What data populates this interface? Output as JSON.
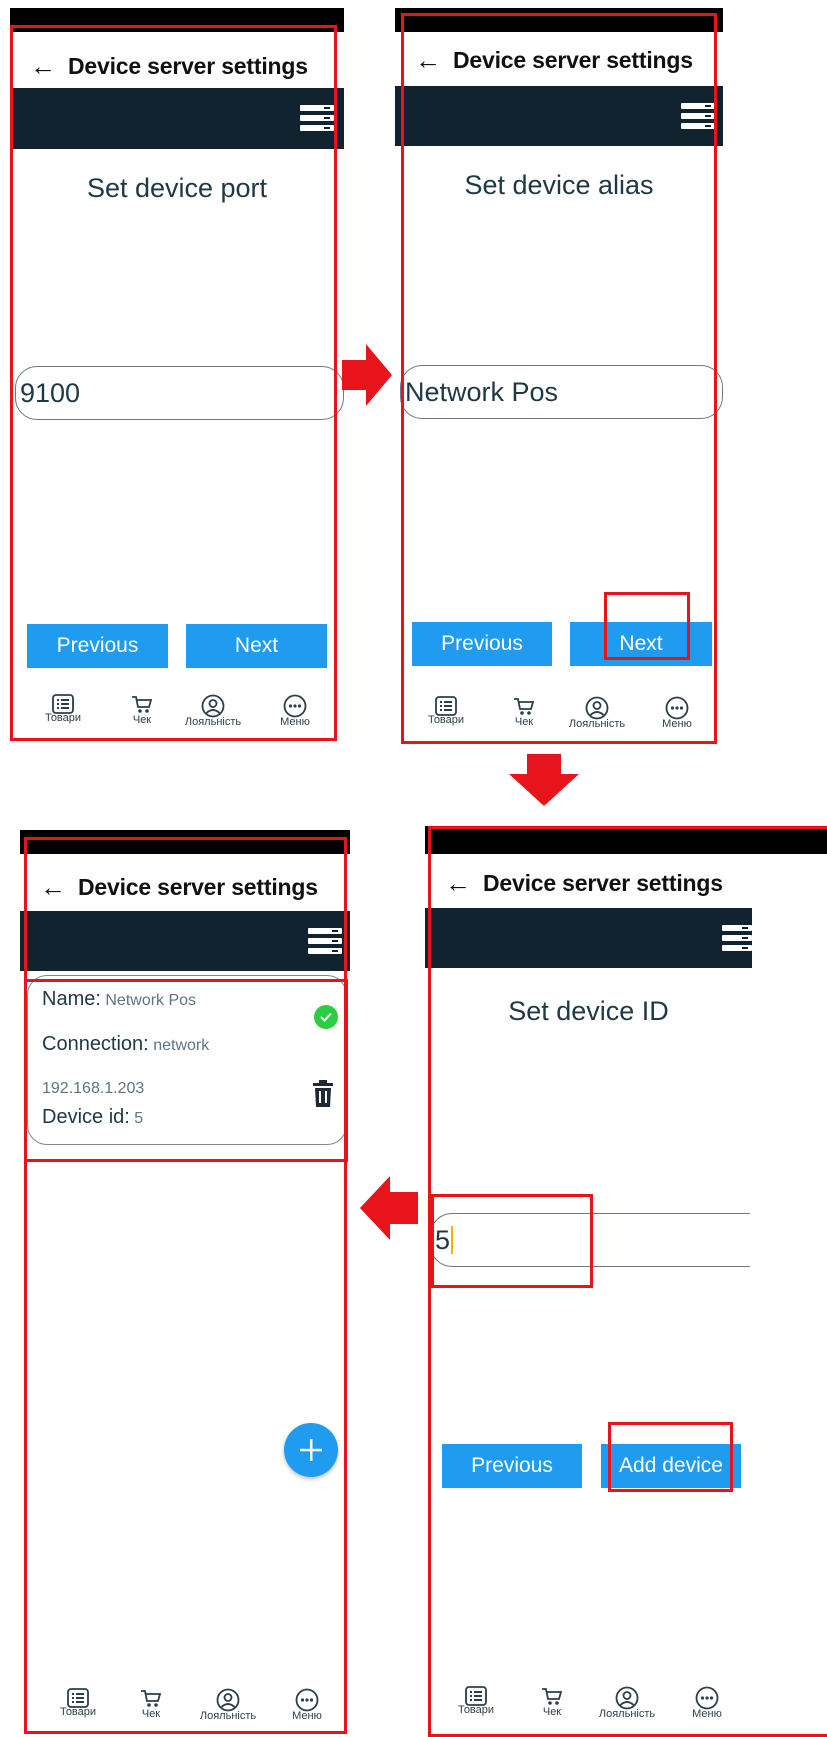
{
  "colors": {
    "status_bar": "#000000",
    "nav_band": "#10232f",
    "accent_blue": "#1f9cf0",
    "highlight_red": "#e8141c",
    "text_dark": "#1f3846",
    "success_green": "#2ecc40"
  },
  "common": {
    "back_icon": "←",
    "title": "Device server settings",
    "server_icon": "server-list-icon",
    "previous_label": "Previous",
    "tabs": [
      {
        "label": "Товари",
        "icon": "list-icon"
      },
      {
        "label": "Чек",
        "icon": "cart-icon"
      },
      {
        "label": "Лояльність",
        "icon": "user-circle-icon"
      },
      {
        "label": "Меню",
        "icon": "more-icon"
      }
    ]
  },
  "panel_port": {
    "heading": "Set device port",
    "input_value": "9100",
    "next_label": "Next"
  },
  "panel_alias": {
    "heading": "Set device alias",
    "input_value": "Network Pos",
    "next_label": "Next"
  },
  "panel_id": {
    "heading": "Set device ID",
    "input_value": "5",
    "add_label": "Add device"
  },
  "panel_list": {
    "device": {
      "name_label": "Name:",
      "name_value": "Network Pos",
      "connection_label": "Connection:",
      "connection_value": "network",
      "ip": "192.168.1.203",
      "id_label": "Device id:",
      "id_value": "5"
    },
    "fab_icon": "plus-icon"
  },
  "flow_arrows": [
    "arrow-right-icon",
    "arrow-down-icon",
    "arrow-left-icon"
  ]
}
